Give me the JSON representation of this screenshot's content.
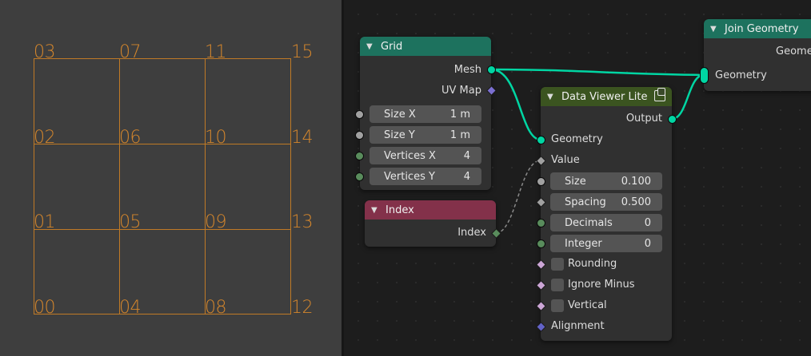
{
  "colors": {
    "grid_node_header": "#1d725e",
    "index_node_header": "#83314a",
    "data_viewer_header": "#3b5420",
    "join_geometry_header": "#1d725e",
    "geometry_socket": "#00d6a3",
    "grid_lines": "#c07a26"
  },
  "viewport": {
    "grid_labels": [
      "03",
      "07",
      "11",
      "15",
      "02",
      "06",
      "10",
      "14",
      "01",
      "05",
      "09",
      "13",
      "00",
      "04",
      "08",
      "12"
    ]
  },
  "nodes": {
    "grid": {
      "title": "Grid",
      "out_mesh": "Mesh",
      "out_uvmap": "UV Map",
      "size_x_label": "Size X",
      "size_x_value": "1 m",
      "size_y_label": "Size Y",
      "size_y_value": "1 m",
      "vertices_x_label": "Vertices X",
      "vertices_x_value": "4",
      "vertices_y_label": "Vertices Y",
      "vertices_y_value": "4"
    },
    "index": {
      "title": "Index",
      "out_index": "Index"
    },
    "data_viewer": {
      "title": "Data Viewer Lite",
      "out_output": "Output",
      "in_geometry": "Geometry",
      "in_value": "Value",
      "size_label": "Size",
      "size_value": "0.100",
      "spacing_label": "Spacing",
      "spacing_value": "0.500",
      "decimals_label": "Decimals",
      "decimals_value": "0",
      "integer_label": "Integer",
      "integer_value": "0",
      "rounding_label": "Rounding",
      "ignore_minus_label": "Ignore Minus",
      "vertical_label": "Vertical",
      "alignment_label": "Alignment"
    },
    "join_geometry": {
      "title": "Join Geometry",
      "out_geometry": "Geome",
      "in_geometry": "Geometry"
    }
  }
}
